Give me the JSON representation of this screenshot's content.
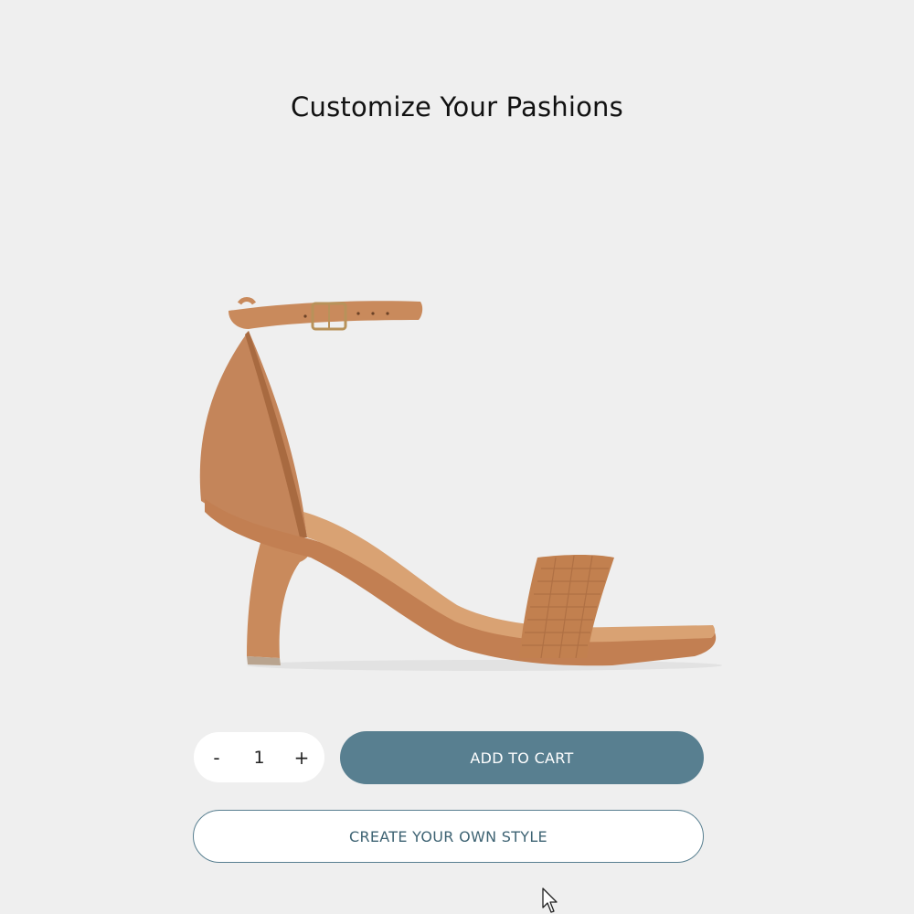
{
  "header": {
    "title": "Customize Your Pashions"
  },
  "product": {
    "image_icon": "tan-ankle-strap-heeled-sandal",
    "colors": {
      "leather": "#c98a5c",
      "leather_dark": "#a86a40",
      "insole": "#d9a273",
      "buckle": "#b8925a"
    }
  },
  "purchase": {
    "decrement_label": "-",
    "quantity": "1",
    "increment_label": "+",
    "add_to_cart_label": "ADD TO CART",
    "create_style_label": "CREATE YOUR OWN STYLE"
  },
  "theme": {
    "accent": "#587f90",
    "background": "#efefef"
  }
}
